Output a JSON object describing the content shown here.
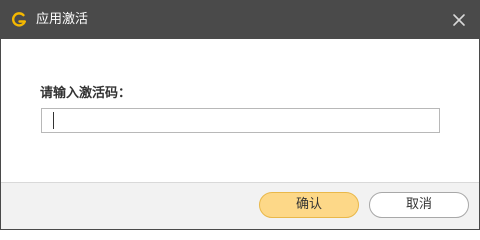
{
  "window": {
    "title": "应用激活",
    "app_icon": "g-logo-icon",
    "close_icon": "close-icon"
  },
  "form": {
    "prompt": "请输入激活码：",
    "code_value": "",
    "code_placeholder": ""
  },
  "buttons": {
    "confirm_label": "确认",
    "cancel_label": "取消"
  },
  "colors": {
    "titlebar": "#4a4a4a",
    "accent": "#fdd888",
    "accent_border": "#e9b84a",
    "logo": "#f5b800"
  }
}
